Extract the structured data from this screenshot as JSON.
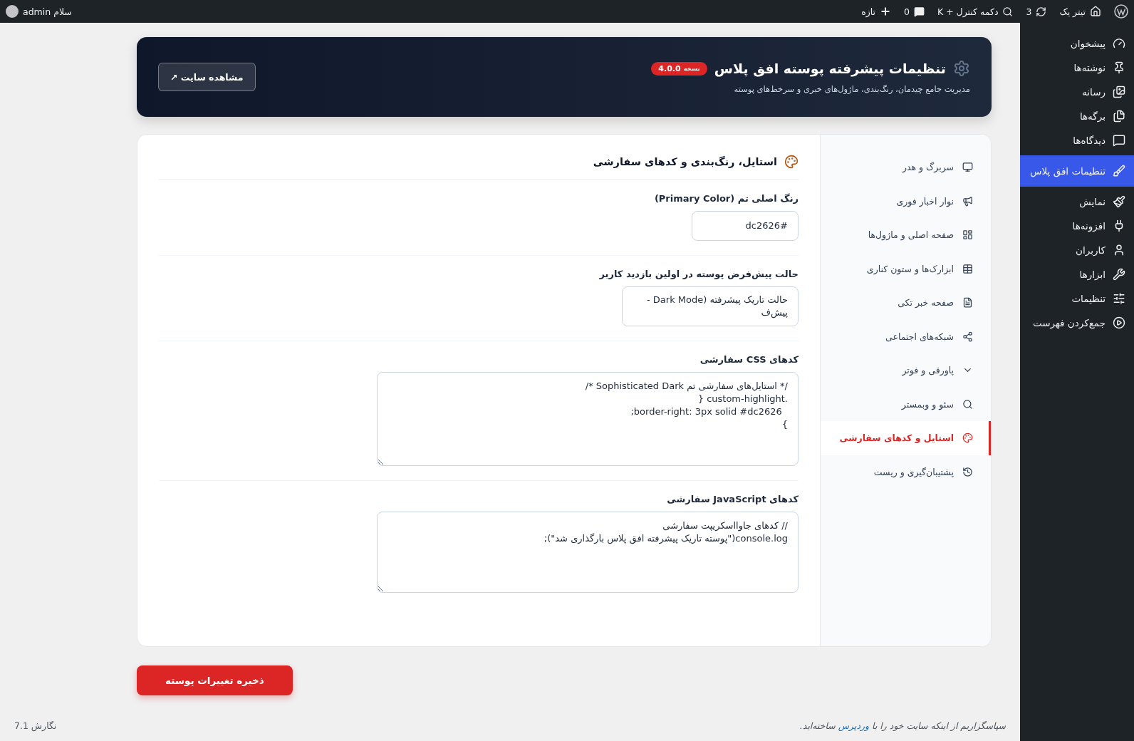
{
  "top_bar": {
    "site": "تیتر یک",
    "updates": "3",
    "search": "دکمه کنترل + K",
    "comments": "0",
    "new": "تازه",
    "greeting": "سلام admin"
  },
  "admin_menu": [
    {
      "label": "پیشخوان",
      "selected": false
    },
    {
      "label": "نوشته‌ها",
      "selected": false
    },
    {
      "label": "رسانه",
      "selected": false
    },
    {
      "label": "برگه‌ها",
      "selected": false
    },
    {
      "label": "دیدگاه‌ها",
      "selected": false
    },
    {
      "label": "تنظیمات افق پلاس",
      "selected": true
    },
    {
      "label": "نمایش",
      "selected": false
    },
    {
      "label": "افزونه‌ها",
      "selected": false
    },
    {
      "label": "کاربران",
      "selected": false
    },
    {
      "label": "ابزارها",
      "selected": false
    },
    {
      "label": "تنظیمات",
      "selected": false
    },
    {
      "label": "جمع‌کردن فهرست",
      "selected": false
    }
  ],
  "header": {
    "title": "تنظیمات پیشرفته پوسته افق پلاس",
    "version_label": "نسخه",
    "version": "4.0.0",
    "subtitle": "مدیریت جامع چیدمان، رنگ‌بندی، ماژول‌های خبری و سرخط‌های پوسته",
    "view_site": "مشاهده سایت ↗"
  },
  "settings_nav": [
    {
      "label": "سربرگ و هدر",
      "selected": false
    },
    {
      "label": "نوار اخبار فوری",
      "selected": false
    },
    {
      "label": "صفحه اصلی و ماژول‌ها",
      "selected": false
    },
    {
      "label": "ابزارک‌ها و ستون کناری",
      "selected": false
    },
    {
      "label": "صفحه خبر تکی",
      "selected": false
    },
    {
      "label": "شبکه‌های اجتماعی",
      "selected": false
    },
    {
      "label": "پاورقی و فوتر",
      "selected": false
    },
    {
      "label": "سئو و وبمستر",
      "selected": false
    },
    {
      "label": "استایل و کدهای سفارشی",
      "selected": true
    },
    {
      "label": "پشتیبان‌گیری و ریست",
      "selected": false
    }
  ],
  "section": {
    "title": "استایل، رنگ‌بندی و کدهای سفارشی",
    "fields": [
      {
        "kind": "color",
        "label": "رنگ اصلی تم (Primary Color)",
        "value": "#dc2626"
      },
      {
        "kind": "select",
        "label": "حالت پیش‌فرض پوسته در اولین بازدید کاربر",
        "value": "حالت تاریک پیشرفته (Dark Mode - پیش‌ف"
      },
      {
        "kind": "code",
        "label": "کدهای CSS سفارشی",
        "value": "/* استایل‌های سفارشی تم Sophisticated Dark */\n.custom-highlight {\n  border-right: 3px solid #dc2626;\n}"
      },
      {
        "kind": "code",
        "label": "کدهای JavaScript سفارشی",
        "value": "// کدهای جاوااسکریپت سفارشی\nconsole.log(\"پوسته تاریک پیشرفته افق پلاس بارگذاری شد\");"
      }
    ]
  },
  "save_button": "ذخیره تغییرات پوسته",
  "footer": {
    "before": "سپاسگزاریم از اینکه سایت خود را با",
    "link": "وردپرس",
    "after": "ساخته‌اید.",
    "version": "نگارش 7.1"
  }
}
